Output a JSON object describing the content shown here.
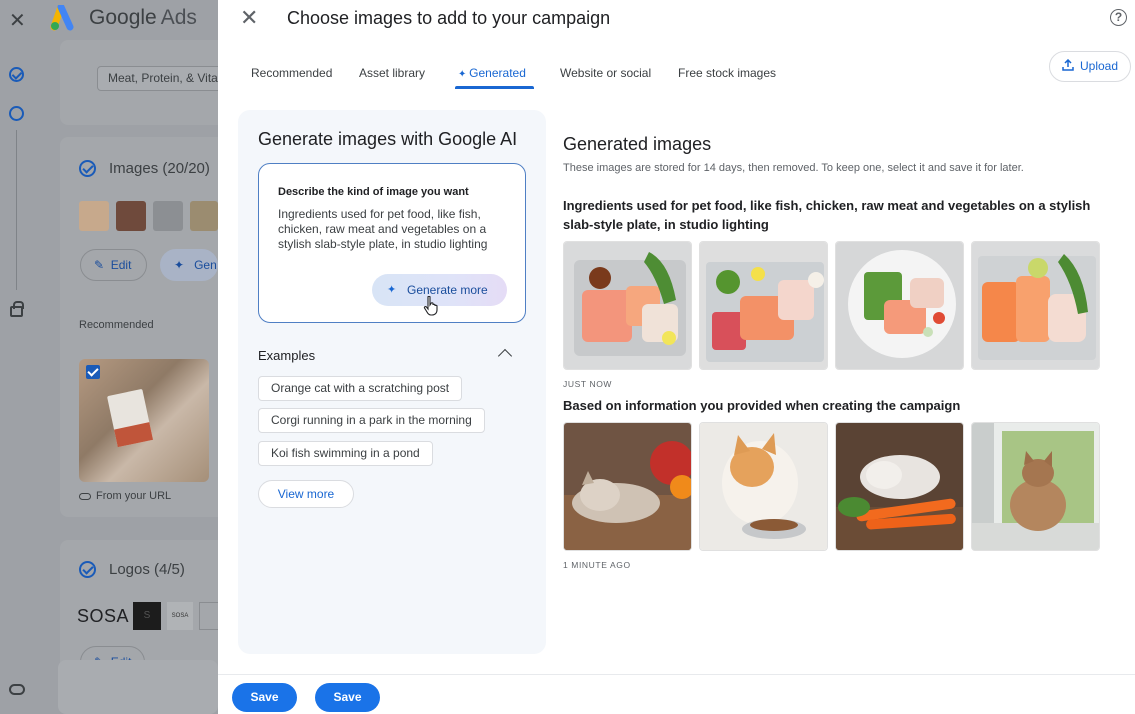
{
  "background": {
    "brand_google": "Google",
    "brand_ads": "Ads",
    "category_chip": "Meat, Protein, & Vita",
    "images_section": "Images (20/20)",
    "edit_label": "Edit",
    "generate_label": "Gen",
    "recommended_label": "Recommended",
    "from_url": "From your URL",
    "logos_section": "Logos (4/5)",
    "logo_text": "SOSA",
    "logo_small_text": "SOSA",
    "logo_black_text": "S",
    "edit_label_2": "Edit"
  },
  "dialog": {
    "title": "Choose images to add to your campaign",
    "help": "?",
    "close": "✕",
    "tabs": [
      {
        "label": "Recommended"
      },
      {
        "label": "Asset library"
      },
      {
        "label": "Generated"
      },
      {
        "label": "Website or social"
      },
      {
        "label": "Free stock images"
      }
    ],
    "upload_label": "Upload"
  },
  "generator": {
    "title": "Generate images with Google AI",
    "prompt_label": "Describe the kind of image you want",
    "prompt_text": "Ingredients used for pet food, like fish, chicken, raw meat and vegetables on a stylish slab-style plate, in studio lighting",
    "generate_more": "Generate more",
    "examples_label": "Examples",
    "examples": [
      "Orange cat with a scratching post",
      "Corgi running in a park in the morning",
      "Koi fish swimming in a pond"
    ],
    "view_more": "View more"
  },
  "results": {
    "title": "Generated images",
    "subtitle": "These images are stored for 14 days, then removed. To keep one, select it and save it for later.",
    "groups": [
      {
        "title": "Ingredients used for pet food, like fish, chicken, raw meat and vegetables on a stylish slab-style plate, in studio lighting",
        "stamp": "JUST NOW"
      },
      {
        "title": "Based on information you provided when creating the campaign",
        "stamp": "1 MINUTE AGO"
      }
    ]
  },
  "footer": {
    "save_1": "Save",
    "save_2": "Save"
  },
  "colors": {
    "accent": "#1967d2",
    "primary_button": "#1a73e8",
    "overlay": "#9ea1a6"
  }
}
